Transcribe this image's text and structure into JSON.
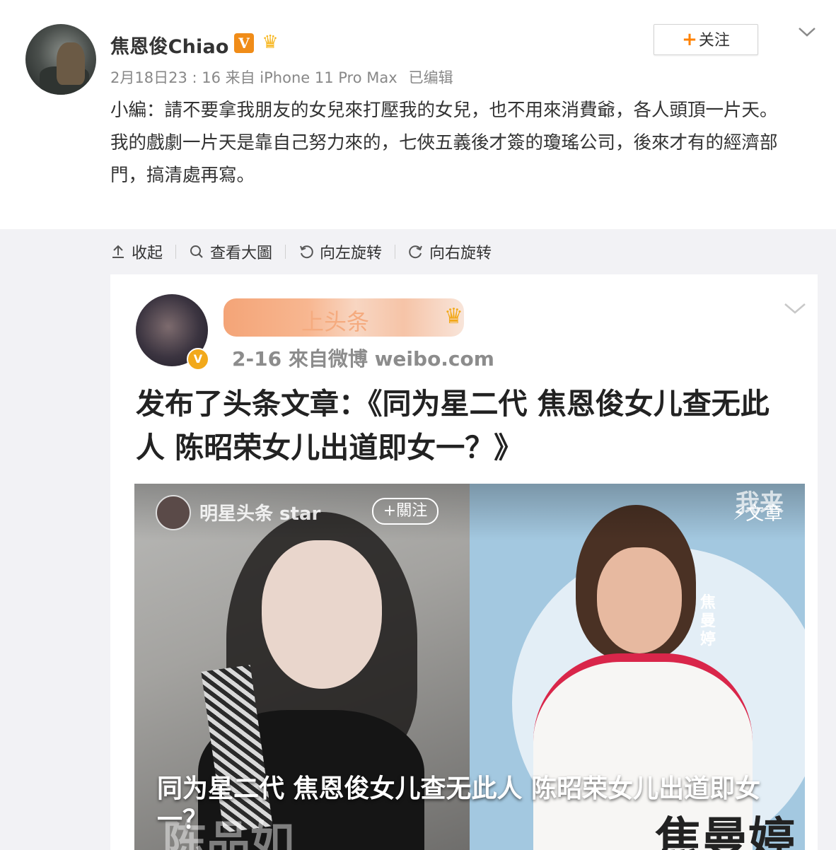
{
  "post": {
    "username": "焦恩俊Chiao",
    "verified_badge": "V",
    "follow_label": "+关注",
    "follow_plus": "+",
    "follow_text": "关注",
    "meta": "2月18日23 : 16 来自 iPhone 11 Pro Max",
    "edited": "已编辑",
    "content_lines": [
      "小編：請不要拿我朋友的女兒來打壓我的女兒，也不用來消費爺，各人頭頂一片天。",
      "我的戲劇一片天是靠自己努力來的，七俠五義後才簽的瓊瑤公司，後來才有的經濟部門，搞清處再寫。"
    ]
  },
  "toolbar": {
    "collapse": "收起",
    "view_large": "查看大圖",
    "rotate_left": "向左旋转",
    "rotate_right": "向右旋转"
  },
  "embed": {
    "name_visible": "上头条",
    "meta": "2-16  來自微博 weibo.com",
    "title": "发布了头条文章：《同为星二代 焦恩俊女儿查无此人 陈昭荣女儿出道即女一？》",
    "thumb": {
      "account": "明星头条 star",
      "follow": "+關注",
      "brand": "我来",
      "article": "文章",
      "vertical_name": "焦曼婷",
      "caption": "同为星二代 焦恩俊女儿查无此人 陈昭荣女儿出道即女一？",
      "big_left": "陈品如",
      "big_right": "焦曼婷"
    }
  },
  "colors": {
    "accent_orange": "#ff8200",
    "text": "#333333",
    "meta_gray": "#888888",
    "media_bg": "#f2f2f5"
  },
  "icons": [
    "crown-icon",
    "chevron-down-icon",
    "collapse-icon",
    "search-icon",
    "rotate-left-icon",
    "rotate-right-icon"
  ]
}
